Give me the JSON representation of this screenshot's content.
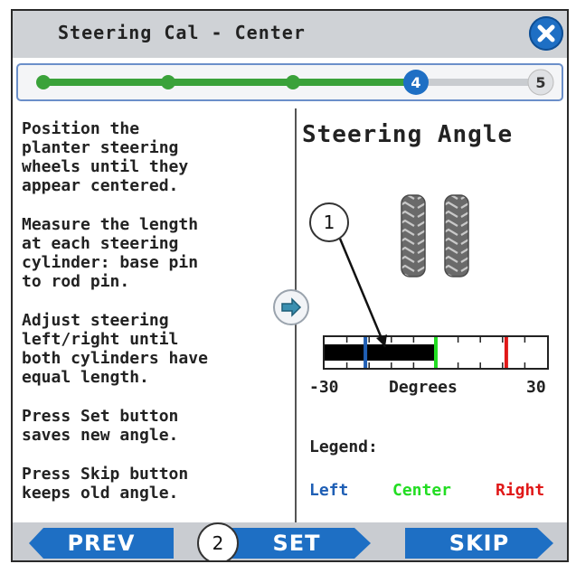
{
  "window": {
    "title": "Steering Cal - Center",
    "close_icon": "close-x-icon"
  },
  "progress": {
    "total_steps": 5,
    "current_step": 4,
    "current_label": "4",
    "last_label": "5",
    "active_color": "#3aa23a",
    "current_color": "#1e6fc4"
  },
  "instructions": {
    "p1": "Position the\nplanter steering\nwheels until they\nappear centered.",
    "p2": "Measure the length\nat each steering\ncylinder: base pin\nto rod pin.",
    "p3": "Adjust steering\nleft/right until\nboth cylinders have\nequal length.",
    "p4": "Press Set button\nsaves new angle.",
    "p5": "Press Skip button\nkeeps old angle."
  },
  "steering": {
    "title": "Steering Angle",
    "scale_min_label": "-30",
    "scale_unit_label": "Degrees",
    "scale_max_label": "30",
    "range": [
      -30,
      30
    ],
    "left_value": -19,
    "center_value": 0,
    "right_value": 19,
    "filled_range": [
      -30,
      0
    ]
  },
  "legend": {
    "label": "Legend:",
    "left": "Left",
    "center": "Center",
    "right": "Right",
    "left_color": "#1f5fb5",
    "center_color": "#22dd22",
    "right_color": "#e01818"
  },
  "callouts": {
    "one": "1",
    "two": "2"
  },
  "buttons": {
    "prev": "PREV",
    "set": "SET",
    "skip": "SKIP",
    "color": "#1e6fc4"
  }
}
